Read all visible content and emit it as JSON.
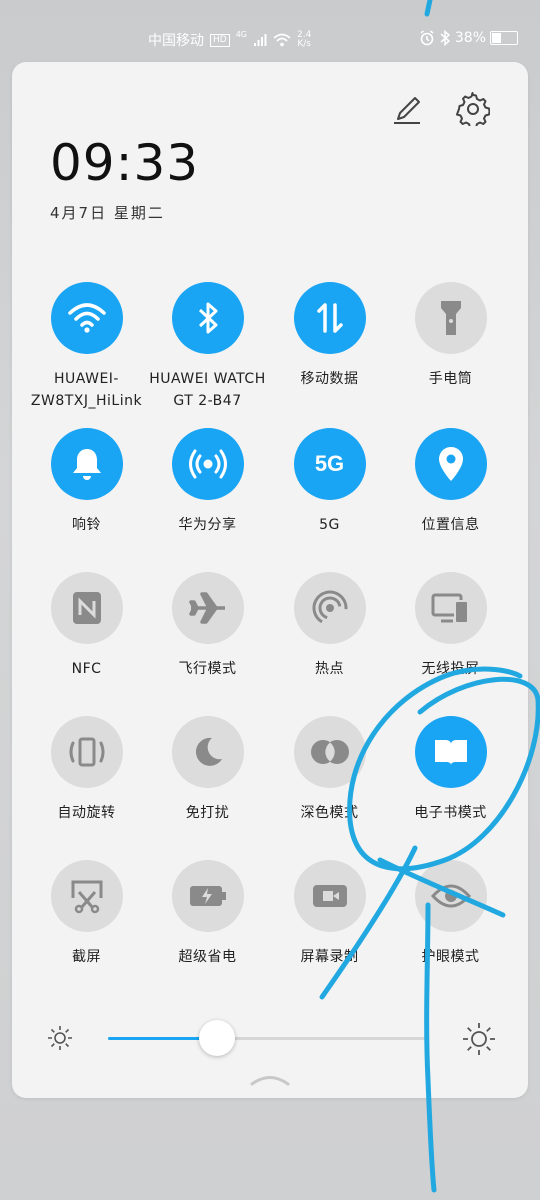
{
  "status_bar": {
    "carrier": "中国移动",
    "hd": "HD",
    "network": "4G",
    "speed_value": "2.4",
    "speed_unit": "K/s",
    "battery_percent": "38%",
    "battery_level": 0.38
  },
  "header": {
    "time": "09:33",
    "date": "4月7日 星期二"
  },
  "colors": {
    "accent": "#1aa5f4",
    "tile_off": "#dcdcdc"
  },
  "toggles": [
    {
      "label": "HUAWEI-\nZW8TXJ_HiLink",
      "icon": "wifi-icon",
      "on": true
    },
    {
      "label": "HUAWEI WATCH\nGT 2-B47",
      "icon": "bluetooth-icon",
      "on": true
    },
    {
      "label": "移动数据",
      "icon": "mobile-data-icon",
      "on": true
    },
    {
      "label": "手电筒",
      "icon": "flashlight-icon",
      "on": false
    },
    {
      "label": "响铃",
      "icon": "bell-icon",
      "on": true
    },
    {
      "label": "华为分享",
      "icon": "huawei-share-icon",
      "on": true
    },
    {
      "label": "5G",
      "icon": "5g-icon",
      "on": true
    },
    {
      "label": "位置信息",
      "icon": "location-icon",
      "on": true
    },
    {
      "label": "NFC",
      "icon": "nfc-icon",
      "on": false
    },
    {
      "label": "飞行模式",
      "icon": "airplane-icon",
      "on": false
    },
    {
      "label": "热点",
      "icon": "hotspot-icon",
      "on": false
    },
    {
      "label": "无线投屏",
      "icon": "wireless-projection-icon",
      "on": false
    },
    {
      "label": "自动旋转",
      "icon": "auto-rotate-icon",
      "on": false
    },
    {
      "label": "免打扰",
      "icon": "moon-icon",
      "on": false
    },
    {
      "label": "深色模式",
      "icon": "dark-mode-icon",
      "on": false
    },
    {
      "label": "电子书模式",
      "icon": "ebook-icon",
      "on": true
    },
    {
      "label": "截屏",
      "icon": "screenshot-icon",
      "on": false
    },
    {
      "label": "超级省电",
      "icon": "battery-saver-icon",
      "on": false
    },
    {
      "label": "屏幕录制",
      "icon": "screen-record-icon",
      "on": false
    },
    {
      "label": "护眼模式",
      "icon": "eye-icon",
      "on": false
    }
  ],
  "brightness": {
    "level": 0.34
  }
}
